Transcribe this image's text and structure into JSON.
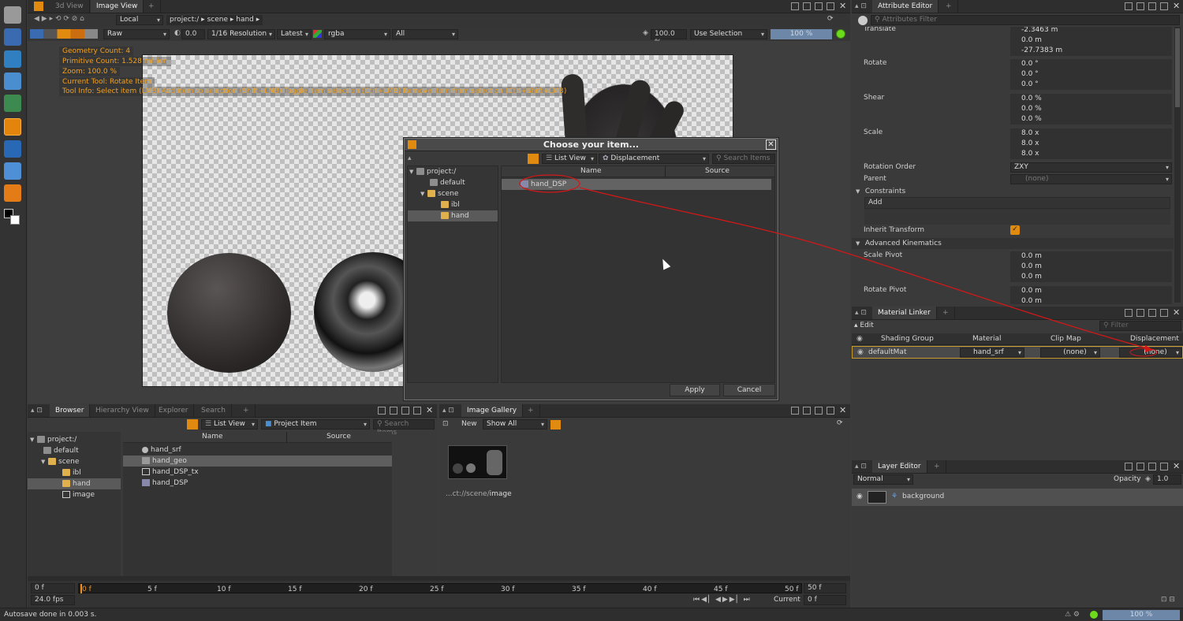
{
  "tabs_view": {
    "tab1": "3d View",
    "tab2": "Image View"
  },
  "path_bar": {
    "mode": "Local",
    "crumbs": [
      "project:/",
      "scene",
      "hand"
    ]
  },
  "view_toolbar": {
    "lut": "Raw",
    "exposure": "0.0",
    "resolution": "1/16 Resolution",
    "version": "Latest",
    "channels": "rgba",
    "layer": "All",
    "zoom": "100.0 %",
    "selection": "Use Selection",
    "progress": "100 %"
  },
  "hud": [
    "Geometry Count: 4",
    "Primitive Count: 1.528 million",
    "Zoom: 100.0 %",
    "Current Tool: Rotate Item",
    "Tool Info: Select item (LMB)  Add item to selection (Shift+LMB)  Toggle item selection (Ctrl+LMB)  Remove item from selection (Ctrl+Shift+LMB)"
  ],
  "dialog": {
    "title": "Choose your item...",
    "view": "List View",
    "filter": "Displacement",
    "search_placeholder": "Search Items",
    "tree": [
      "project:/",
      "default",
      "scene",
      "ibl",
      "hand"
    ],
    "col_name": "Name",
    "col_source": "Source",
    "item": "hand_DSP",
    "apply": "Apply",
    "cancel": "Cancel"
  },
  "browser": {
    "tabs": [
      "Browser",
      "Hierarchy View",
      "Explorer",
      "Search"
    ],
    "view": "List View",
    "filter": "Project Item",
    "search_placeholder": "Search Items",
    "tree": [
      "project:/",
      "default",
      "scene",
      "ibl",
      "hand",
      "image"
    ],
    "col_name": "Name",
    "col_source": "Source",
    "items": [
      "hand_srf",
      "hand_geo",
      "hand_DSP_tx",
      "hand_DSP"
    ]
  },
  "gallery": {
    "tab": "Image Gallery",
    "new": "New",
    "show": "Show All",
    "caption_prefix": "...ct://scene/",
    "caption_name": "image"
  },
  "attr": {
    "tab": "Attribute Editor",
    "filter_placeholder": "Attributes Filter",
    "translate": "Translate",
    "translate_vals": [
      "-2.3463 m",
      "0.0 m",
      "-27.7383 m"
    ],
    "rotate": "Rotate",
    "rotate_vals": [
      "0.0 °",
      "0.0 °",
      "0.0 °"
    ],
    "shear": "Shear",
    "shear_vals": [
      "0.0 %",
      "0.0 %",
      "0.0 %"
    ],
    "scale": "Scale",
    "scale_vals": [
      "8.0 x",
      "8.0 x",
      "8.0 x"
    ],
    "rotation_order": "Rotation Order",
    "rotation_order_val": "ZXY",
    "parent": "Parent",
    "parent_val": "(none)",
    "constraints": "Constraints",
    "add": "Add",
    "inherit": "Inherit Transform",
    "advanced": "Advanced Kinematics",
    "scale_pivot": "Scale Pivot",
    "scale_pivot_vals": [
      "0.0 m",
      "0.0 m",
      "0.0 m"
    ],
    "rotate_pivot": "Rotate Pivot",
    "rotate_pivot_vals": [
      "0.0 m",
      "0.0 m"
    ]
  },
  "material": {
    "tab": "Material Linker",
    "edit": "Edit",
    "filter_placeholder": "Filter",
    "cols": [
      "Shading Group",
      "Material",
      "Clip Map",
      "Displacement"
    ],
    "row": {
      "group": "defaultMat",
      "material": "hand_srf",
      "clip": "(none)",
      "disp": "(none)"
    }
  },
  "layer": {
    "tab": "Layer Editor",
    "blend": "Normal",
    "opacity_label": "Opacity",
    "opacity": "1.0",
    "layer_name": "background"
  },
  "timeline": {
    "start": "0 f",
    "end": "50 f",
    "ticks": [
      "0 f",
      "5 f",
      "10 f",
      "15 f",
      "20 f",
      "25 f",
      "30 f",
      "35 f",
      "40 f",
      "45 f",
      "50 f"
    ],
    "fps": "24.0 fps",
    "current_label": "Current",
    "current": "0 f"
  },
  "status": {
    "message": "Autosave done in 0.003 s.",
    "progress": "100 %"
  }
}
